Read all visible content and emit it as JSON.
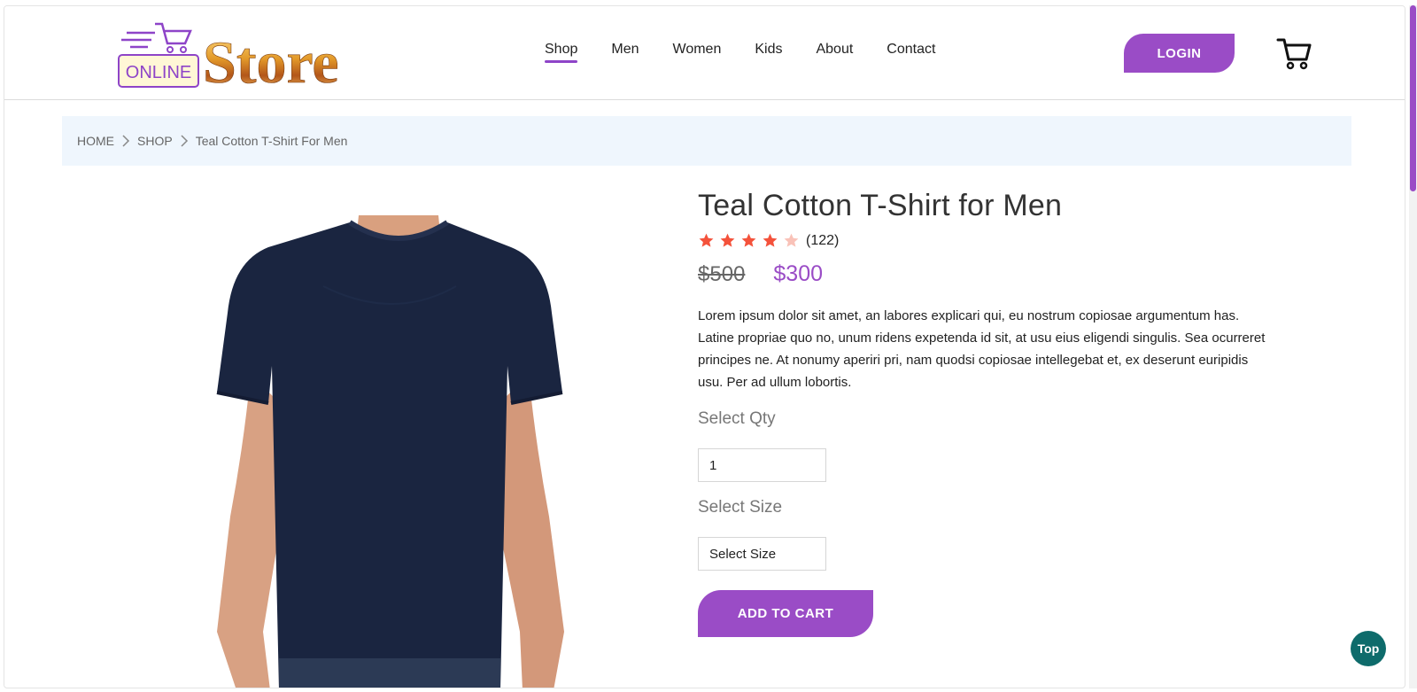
{
  "header": {
    "logo": {
      "badge_text": "ONLINE",
      "brand_text": "Store"
    },
    "nav": [
      {
        "label": "Shop",
        "active": true
      },
      {
        "label": "Men"
      },
      {
        "label": "Women"
      },
      {
        "label": "Kids"
      },
      {
        "label": "About"
      },
      {
        "label": "Contact"
      }
    ],
    "login_label": "LOGIN",
    "cart_icon": "shopping-cart-icon"
  },
  "breadcrumb": {
    "items": [
      "HOME",
      "SHOP",
      "Teal Cotton T-Shirt For Men"
    ]
  },
  "product": {
    "title": "Teal Cotton T-Shirt for Men",
    "rating": 4,
    "rating_max": 5,
    "review_count": "(122)",
    "old_price": "$500",
    "new_price": "$300",
    "description": "Lorem ipsum dolor sit amet, an labores explicari qui, eu nostrum copiosae argumentum has. Latine propriae quo no, unum ridens expetenda id sit, at usu eius eligendi singulis. Sea ocurreret principes ne. At nonumy aperiri pri, nam quodsi copiosae intellegebat et, ex deserunt euripidis usu. Per ad ullum lobortis.",
    "qty_label": "Select Qty",
    "qty_value": "1",
    "size_label": "Select Size",
    "size_selected": "Select Size",
    "add_to_cart_label": "ADD TO CART"
  },
  "top_button_label": "Top",
  "colors": {
    "accent": "#9a4cc6",
    "star": "#f4523b",
    "star_empty": "#f9c2b8",
    "breadcrumb_bg": "#eff6fd",
    "top_button": "#0e6b6b"
  }
}
